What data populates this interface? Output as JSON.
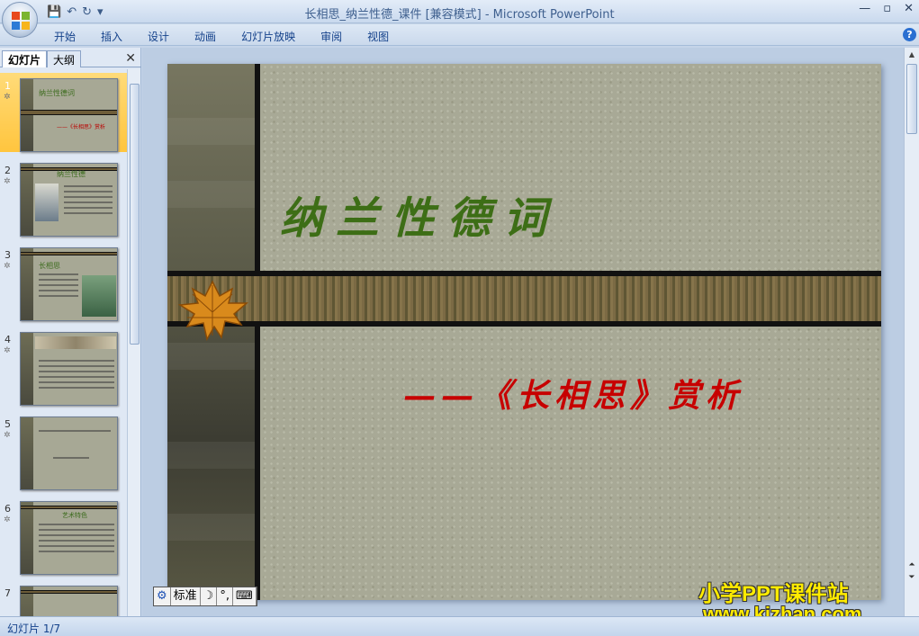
{
  "window": {
    "title": "长相思_纳兰性德_课件 [兼容模式] - Microsoft PowerPoint",
    "controls": [
      "—",
      "▫",
      "✕"
    ]
  },
  "ribbon": {
    "tabs": [
      "开始",
      "插入",
      "设计",
      "动画",
      "幻灯片放映",
      "审阅",
      "视图"
    ],
    "help": "?"
  },
  "left_pane": {
    "tab_slides": "幻灯片",
    "tab_outline": "大纲",
    "close": "✕",
    "thumbnails": [
      {
        "number": "1",
        "title": "纳兰性德词",
        "subtitle": "——《长相思》赏析"
      },
      {
        "number": "2",
        "title": "纳兰性德"
      },
      {
        "number": "3",
        "title": "长相思"
      },
      {
        "number": "4"
      },
      {
        "number": "5"
      },
      {
        "number": "6",
        "title": "艺术特色"
      },
      {
        "number": "7"
      }
    ]
  },
  "slide": {
    "title": "纳兰性德词",
    "subtitle": "——《长相思》赏析"
  },
  "ime": {
    "mode": "标准",
    "moon": "☽",
    "punct": "°,",
    "keyboard": "⌨"
  },
  "watermark": {
    "line1": "小学PPT课件站",
    "line2": "www.kjzhan.com"
  },
  "status": {
    "slide_counter": "幻灯片 1/7"
  },
  "colors": {
    "title_green": "#3d6e16",
    "subtitle_red": "#c70000",
    "selection": "#ffc53e"
  }
}
